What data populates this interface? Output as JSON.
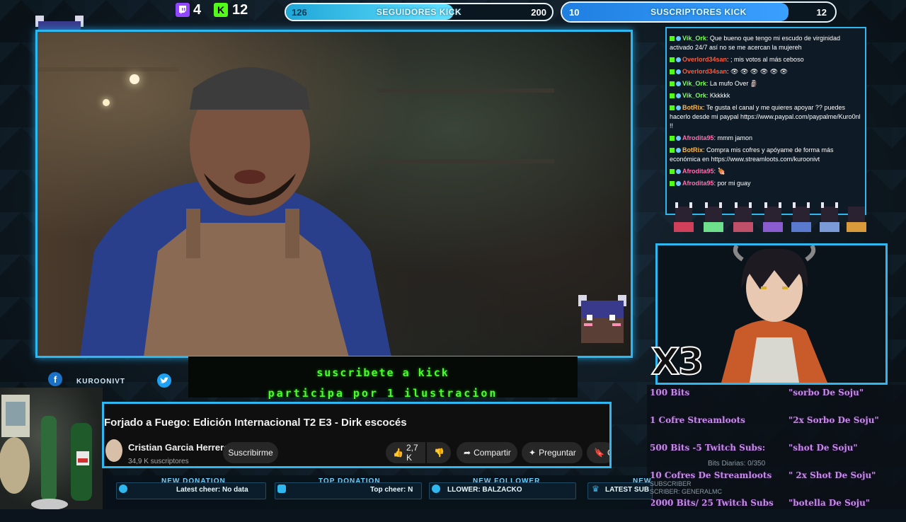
{
  "top_bar": {
    "twitch_count": "4",
    "kick_count": "12",
    "followers_goal": {
      "current": "126",
      "label": "SEGUIDORES KICK",
      "target": "200",
      "progress": 0.63
    },
    "subs_goal": {
      "current": "10",
      "label": "SUSCRIPTORES KICK",
      "target": "12",
      "progress": 0.83
    }
  },
  "chat": {
    "messages": [
      {
        "user": "Vik_Ork",
        "color": "#7cff5a",
        "text": ": Que bueno que tengo mi escudo de virginidad activado 24/7 así no se me acercan la mujereh"
      },
      {
        "user": "Overlord34san",
        "color": "#ff5a3a",
        "text": ": ; mis votos al más ceboso"
      },
      {
        "user": "Overlord34san",
        "color": "#ff5a3a",
        "text": ": 👁 👁 👁 👁 👁 👁"
      },
      {
        "user": "Vik_Ork",
        "color": "#7cff5a",
        "text": ": La mufo Over 🗿"
      },
      {
        "user": "Vik_Ork",
        "color": "#7cff5a",
        "text": ": Kkkkkk"
      },
      {
        "user": "BotRix",
        "color": "#ffb84a",
        "text": ": Te gusta el canal y me quieres apoyar ?? puedes hacerlo desde mi paypal https://www.paypal.com/paypalme/Kuro0nl !!"
      },
      {
        "user": "Afrodita95",
        "color": "#ff6fb0",
        "text": ": mmm jamon"
      },
      {
        "user": "BotRix",
        "color": "#ffb84a",
        "text": ": Compra mis cofres y apóyame de forma más económica en https://www.streamloots.com/kuroonivt"
      },
      {
        "user": "Afrodita95",
        "color": "#ff6fb0",
        "text": ": 🍖"
      },
      {
        "user": "Afrodita95",
        "color": "#ff6fb0",
        "text": ": por mi guay"
      }
    ]
  },
  "multiplier": "X3",
  "rewards": [
    {
      "cost": "100 Bits",
      "reward": "\"sorbo De Soju\""
    },
    {
      "cost": "1 Cofre Streamloots",
      "reward": "\"2x Sorbo De Soju\""
    },
    {
      "cost": "500 Bits -5 Twitch Subs:",
      "reward": "\"shot De Soju\""
    },
    {
      "cost": "10 Cofres De Streamloots",
      "reward": "\" 2x Shot De Soju\""
    },
    {
      "cost": "2000 Bits/ 25 Twitch Subs",
      "reward": "\"botella De Soju\""
    }
  ],
  "bits_daily": "Bits Diarias: 0/350",
  "social": {
    "handle": "KUROONIVT"
  },
  "banner": {
    "line1": "suscribete a kick",
    "line2": "participa por 1 ilustracion"
  },
  "youtube": {
    "title": "Forjado a Fuego: Edición Internacional T2 E3 - Dirk escocés",
    "channel": "Cristian Garcia Herrero",
    "subscribers": "34,9 K suscriptores",
    "subscribe_label": "Suscribirme",
    "likes": "2,7 K",
    "share_label": "Compartir",
    "ask_label": "Preguntar",
    "save_label": "G"
  },
  "ticker": {
    "new_donation_label": "NEW DONATION",
    "latest_cheer": "Latest cheer: No data",
    "top_donation_label": "TOP DONATION",
    "top_cheer": "Top cheer: N",
    "new_follower_label": "NEW FOLLOWER",
    "follower": "LLOWER: BALZACKO",
    "latest_sub": "LATEST SUB",
    "new_sub_label": "NEW",
    "subscriber": "SCRIBER: GENERALMC",
    "subscriber_prefix": "SUBSCRIBER"
  },
  "colors": {
    "accent": "#2fb8f0",
    "kick_green": "#53fc18",
    "twitch_purple": "#9146ff",
    "neon_green": "#49ff2a",
    "reward_purple": "#c58be8"
  }
}
